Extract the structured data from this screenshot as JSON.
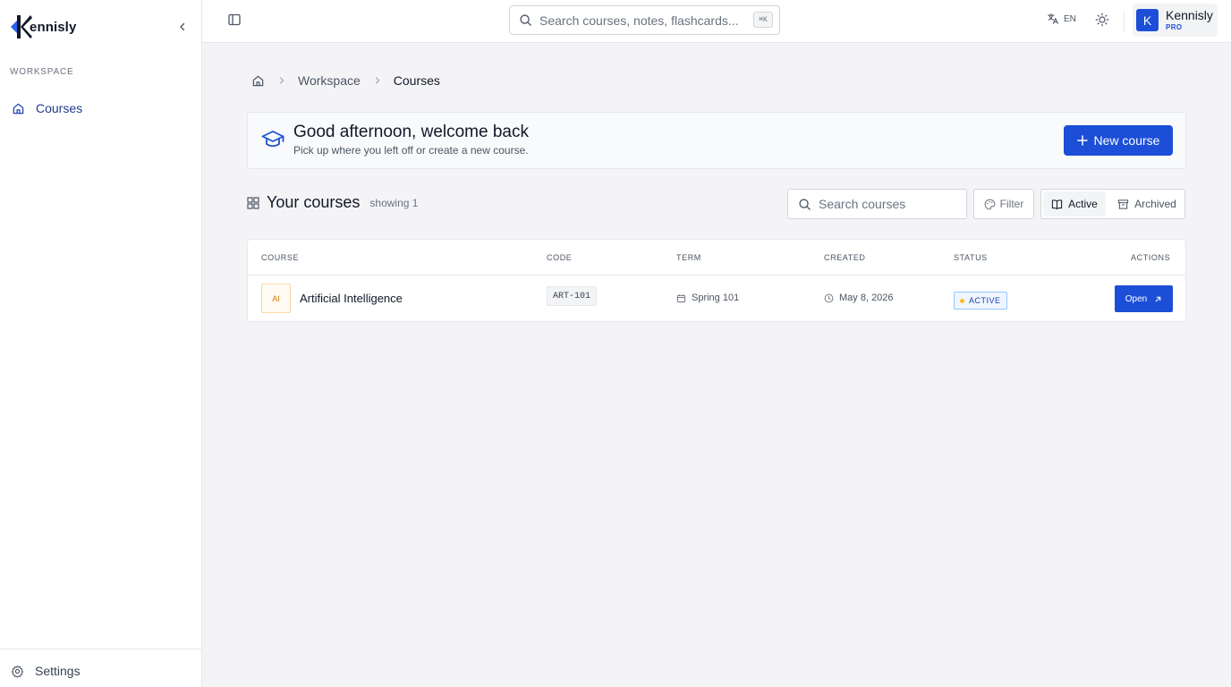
{
  "brand": {
    "logo_text": "ennisly",
    "accent": "#1d4ed8",
    "logo_dark": "#111827",
    "logo_blue": "#2563eb"
  },
  "sidebar": {
    "section_label": "WORKSPACE",
    "items": [
      {
        "label": "Courses",
        "icon": "home-icon"
      }
    ],
    "settings_label": "Settings"
  },
  "topbar": {
    "search_placeholder": "Search courses, notes, flashcards...",
    "shortcut": "⌘K",
    "language": "EN",
    "user": {
      "initial": "K",
      "name": "Kennisly",
      "plan": "PRO"
    }
  },
  "breadcrumb": {
    "workspace": "Workspace",
    "current": "Courses"
  },
  "welcome": {
    "title": "Good afternoon, welcome back",
    "subtitle": "Pick up where you left off or create a new course.",
    "new_course_label": "New course"
  },
  "courses": {
    "title": "Your courses",
    "count_label": "showing 1",
    "search_placeholder": "Search courses",
    "filter_label": "Filter",
    "active_label": "Active",
    "archived_label": "Archived"
  },
  "table": {
    "columns": {
      "course": "COURSE",
      "code": "CODE",
      "term": "TERM",
      "created": "CREATED",
      "status": "STATUS",
      "actions": "ACTIONS"
    },
    "rows": [
      {
        "badge": "AI",
        "name": "Artificial Intelligence",
        "code": "ART-101",
        "term": "Spring 101",
        "created": "May 8, 2026",
        "status": "ACTIVE",
        "action": "Open"
      }
    ]
  }
}
